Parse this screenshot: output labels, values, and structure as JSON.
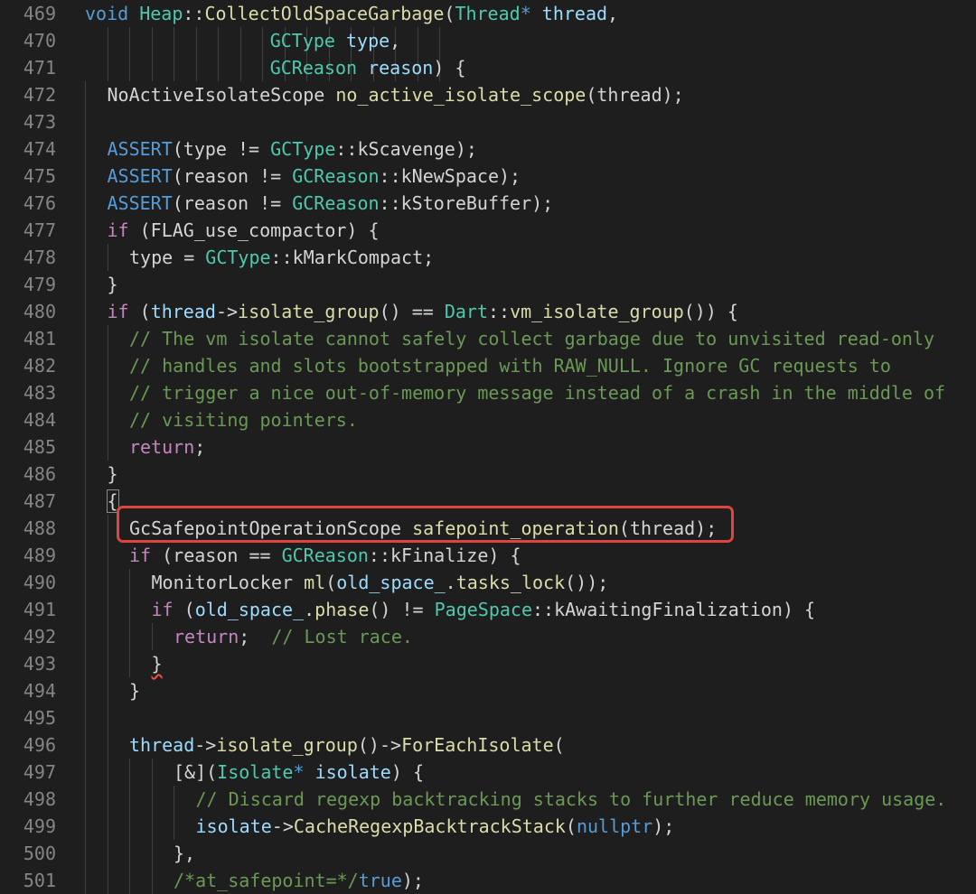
{
  "colors": {
    "background": "#1e1e1e",
    "line_number": "#858585",
    "keyword": "#569cd6",
    "control_keyword": "#c586c0",
    "type": "#4ec9b0",
    "function": "#dcdcaa",
    "variable": "#9cdcfe",
    "comment": "#6a9955",
    "plain": "#d4d4d4",
    "highlight_box": "#e0443e"
  },
  "highlighted_line_number": "488",
  "lines": [
    {
      "n": "469",
      "indent": 0,
      "guides": [],
      "tokens": [
        [
          "void",
          "kw"
        ],
        [
          " ",
          "pl"
        ],
        [
          "Heap",
          "ty"
        ],
        [
          "::",
          "pl"
        ],
        [
          "CollectOldSpaceGarbage",
          "fn"
        ],
        [
          "(",
          "pl"
        ],
        [
          "Thread",
          "ty"
        ],
        [
          "*",
          "kw"
        ],
        [
          " ",
          "pl"
        ],
        [
          "thread",
          "va"
        ],
        [
          ",",
          "pl"
        ]
      ]
    },
    {
      "n": "470",
      "indent": 0,
      "guides": [
        1,
        2,
        3,
        4,
        5,
        6,
        7,
        8,
        9,
        10,
        11,
        12,
        13,
        14,
        15,
        16
      ],
      "tokens": [
        [
          "                 ",
          "pl"
        ],
        [
          "GCType",
          "ty"
        ],
        [
          " ",
          "pl"
        ],
        [
          "type",
          "va"
        ],
        [
          ",",
          "pl"
        ]
      ]
    },
    {
      "n": "471",
      "indent": 0,
      "guides": [
        1,
        2,
        3,
        4,
        5,
        6,
        7,
        8,
        9,
        10,
        11,
        12,
        13,
        14,
        15,
        16
      ],
      "tokens": [
        [
          "                 ",
          "pl"
        ],
        [
          "GCReason",
          "ty"
        ],
        [
          " ",
          "pl"
        ],
        [
          "reason",
          "va"
        ],
        [
          ") {",
          "pl"
        ]
      ]
    },
    {
      "n": "472",
      "indent": 1,
      "guides": [
        0
      ],
      "tokens": [
        [
          "NoActiveIsolateScope",
          "pl"
        ],
        [
          " ",
          "pl"
        ],
        [
          "no_active_isolate_scope",
          "fn"
        ],
        [
          "(thread);",
          "pl"
        ]
      ]
    },
    {
      "n": "473",
      "indent": 1,
      "guides": [
        0
      ],
      "tokens": []
    },
    {
      "n": "474",
      "indent": 1,
      "guides": [
        0
      ],
      "tokens": [
        [
          "ASSERT",
          "kw"
        ],
        [
          "(type != ",
          "pl"
        ],
        [
          "GCType",
          "ty"
        ],
        [
          "::kScavenge);",
          "pl"
        ]
      ]
    },
    {
      "n": "475",
      "indent": 1,
      "guides": [
        0
      ],
      "tokens": [
        [
          "ASSERT",
          "kw"
        ],
        [
          "(reason != ",
          "pl"
        ],
        [
          "GCReason",
          "ty"
        ],
        [
          "::kNewSpace);",
          "pl"
        ]
      ]
    },
    {
      "n": "476",
      "indent": 1,
      "guides": [
        0
      ],
      "tokens": [
        [
          "ASSERT",
          "kw"
        ],
        [
          "(reason != ",
          "pl"
        ],
        [
          "GCReason",
          "ty"
        ],
        [
          "::kStoreBuffer);",
          "pl"
        ]
      ]
    },
    {
      "n": "477",
      "indent": 1,
      "guides": [
        0
      ],
      "tokens": [
        [
          "if",
          "kc"
        ],
        [
          " (FLAG_use_compactor) {",
          "pl"
        ]
      ]
    },
    {
      "n": "478",
      "indent": 2,
      "guides": [
        0,
        1
      ],
      "tokens": [
        [
          "type = ",
          "pl"
        ],
        [
          "GCType",
          "ty"
        ],
        [
          "::kMarkCompact;",
          "pl"
        ]
      ]
    },
    {
      "n": "479",
      "indent": 1,
      "guides": [
        0
      ],
      "tokens": [
        [
          "}",
          "pl"
        ]
      ]
    },
    {
      "n": "480",
      "indent": 1,
      "guides": [
        0
      ],
      "tokens": [
        [
          "if",
          "kc"
        ],
        [
          " (",
          "pl"
        ],
        [
          "thread",
          "va"
        ],
        [
          "->",
          "pl"
        ],
        [
          "isolate_group",
          "fn"
        ],
        [
          "() == ",
          "pl"
        ],
        [
          "Dart",
          "ty"
        ],
        [
          "::",
          "pl"
        ],
        [
          "vm_isolate_group",
          "fn"
        ],
        [
          "()) {",
          "pl"
        ]
      ]
    },
    {
      "n": "481",
      "indent": 2,
      "guides": [
        0,
        1
      ],
      "tokens": [
        [
          "// The vm isolate cannot safely collect garbage due to unvisited read-only",
          "cm"
        ]
      ]
    },
    {
      "n": "482",
      "indent": 2,
      "guides": [
        0,
        1
      ],
      "tokens": [
        [
          "// handles and slots bootstrapped with RAW_NULL. Ignore GC requests to",
          "cm"
        ]
      ]
    },
    {
      "n": "483",
      "indent": 2,
      "guides": [
        0,
        1
      ],
      "tokens": [
        [
          "// trigger a nice out-of-memory message instead of a crash in the middle of",
          "cm"
        ]
      ]
    },
    {
      "n": "484",
      "indent": 2,
      "guides": [
        0,
        1
      ],
      "tokens": [
        [
          "// visiting pointers.",
          "cm"
        ]
      ]
    },
    {
      "n": "485",
      "indent": 2,
      "guides": [
        0,
        1
      ],
      "tokens": [
        [
          "return",
          "kc"
        ],
        [
          ";",
          "pl"
        ]
      ]
    },
    {
      "n": "486",
      "indent": 1,
      "guides": [
        0
      ],
      "tokens": [
        [
          "}",
          "pl"
        ]
      ]
    },
    {
      "n": "487",
      "indent": 1,
      "guides": [
        0
      ],
      "tokens": [
        [
          "{",
          "bm"
        ]
      ]
    },
    {
      "n": "488",
      "indent": 2,
      "guides": [
        0,
        1
      ],
      "tokens": [
        [
          "GcSafepointOperationScope",
          "pl"
        ],
        [
          " ",
          "pl"
        ],
        [
          "safepoint_operation",
          "fn"
        ],
        [
          "(thread);",
          "pl"
        ]
      ]
    },
    {
      "n": "489",
      "indent": 2,
      "guides": [
        0,
        1
      ],
      "tokens": [
        [
          "if",
          "kc"
        ],
        [
          " (reason == ",
          "pl"
        ],
        [
          "GCReason",
          "ty"
        ],
        [
          "::kFinalize) {",
          "pl"
        ]
      ]
    },
    {
      "n": "490",
      "indent": 3,
      "guides": [
        0,
        1,
        2
      ],
      "tokens": [
        [
          "MonitorLocker",
          "pl"
        ],
        [
          " ",
          "pl"
        ],
        [
          "ml",
          "fn"
        ],
        [
          "(",
          "pl"
        ],
        [
          "old_space_",
          "va"
        ],
        [
          ".",
          "pl"
        ],
        [
          "tasks_lock",
          "fn"
        ],
        [
          "());",
          "pl"
        ]
      ]
    },
    {
      "n": "491",
      "indent": 3,
      "guides": [
        0,
        1,
        2
      ],
      "tokens": [
        [
          "if",
          "kc"
        ],
        [
          " (",
          "pl"
        ],
        [
          "old_space_",
          "va"
        ],
        [
          ".",
          "pl"
        ],
        [
          "phase",
          "fn"
        ],
        [
          "() != ",
          "pl"
        ],
        [
          "PageSpace",
          "ty"
        ],
        [
          "::kAwaitingFinalization) {",
          "pl"
        ]
      ]
    },
    {
      "n": "492",
      "indent": 4,
      "guides": [
        0,
        1,
        2,
        3
      ],
      "tokens": [
        [
          "return",
          "kc"
        ],
        [
          ";  ",
          "pl"
        ],
        [
          "// Lost race.",
          "cm"
        ]
      ]
    },
    {
      "n": "493",
      "indent": 3,
      "guides": [
        0,
        1,
        2
      ],
      "tokens": [
        [
          "}",
          "sq"
        ]
      ]
    },
    {
      "n": "494",
      "indent": 2,
      "guides": [
        0,
        1
      ],
      "tokens": [
        [
          "}",
          "pl"
        ]
      ]
    },
    {
      "n": "495",
      "indent": 2,
      "guides": [
        0,
        1
      ],
      "tokens": []
    },
    {
      "n": "496",
      "indent": 2,
      "guides": [
        0,
        1
      ],
      "tokens": [
        [
          "thread",
          "va"
        ],
        [
          "->",
          "pl"
        ],
        [
          "isolate_group",
          "fn"
        ],
        [
          "()->",
          "pl"
        ],
        [
          "ForEachIsolate",
          "fn"
        ],
        [
          "(",
          "pl"
        ]
      ]
    },
    {
      "n": "497",
      "indent": 4,
      "guides": [
        0,
        1,
        2,
        3
      ],
      "tokens": [
        [
          "[&](",
          "pl"
        ],
        [
          "Isolate",
          "ty"
        ],
        [
          "*",
          "kw"
        ],
        [
          " ",
          "pl"
        ],
        [
          "isolate",
          "va"
        ],
        [
          ") {",
          "pl"
        ]
      ]
    },
    {
      "n": "498",
      "indent": 5,
      "guides": [
        0,
        1,
        2,
        3,
        4
      ],
      "tokens": [
        [
          "// Discard regexp backtracking stacks to further reduce memory usage.",
          "cm"
        ]
      ]
    },
    {
      "n": "499",
      "indent": 5,
      "guides": [
        0,
        1,
        2,
        3,
        4
      ],
      "tokens": [
        [
          "isolate",
          "va"
        ],
        [
          "->",
          "pl"
        ],
        [
          "CacheRegexpBacktrackStack",
          "fn"
        ],
        [
          "(",
          "pl"
        ],
        [
          "nullptr",
          "kw"
        ],
        [
          ");",
          "pl"
        ]
      ]
    },
    {
      "n": "500",
      "indent": 4,
      "guides": [
        0,
        1,
        2,
        3
      ],
      "tokens": [
        [
          "},",
          "pl"
        ]
      ]
    },
    {
      "n": "501",
      "indent": 4,
      "guides": [
        0,
        1,
        2,
        3
      ],
      "tokens": [
        [
          "/*at_safepoint=*/",
          "cm"
        ],
        [
          "true",
          "kw"
        ],
        [
          ");",
          "pl"
        ]
      ]
    }
  ]
}
